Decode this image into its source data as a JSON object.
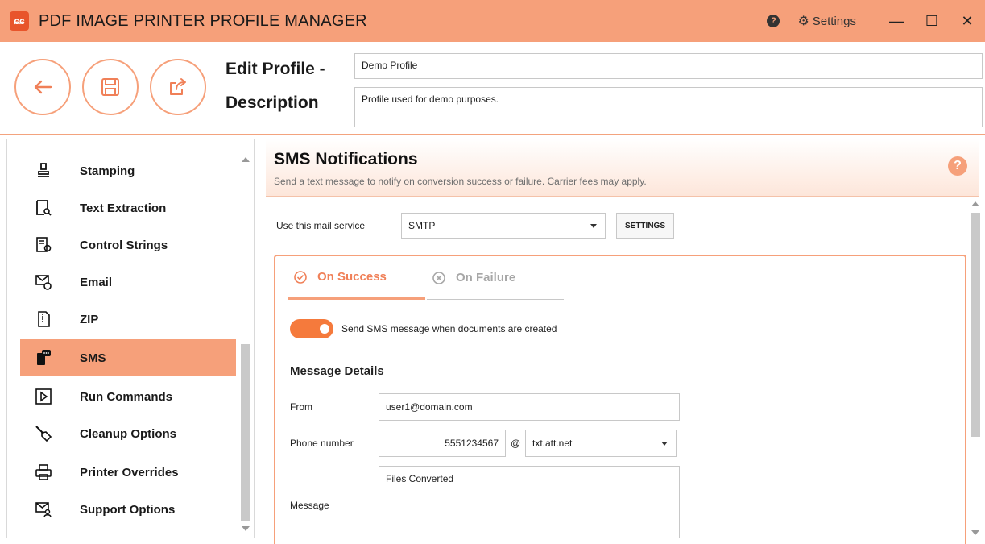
{
  "titlebar": {
    "logo_text": "ɕɕ",
    "title": "PDF IMAGE PRINTER PROFILE MANAGER",
    "help_glyph": "?",
    "settings_label": "Settings",
    "minimize": "—",
    "maximize": "☐",
    "close": "✕"
  },
  "header": {
    "edit_profile_label": "Edit Profile -",
    "profile_name": "Demo Profile",
    "description_label": "Description",
    "description_value": "Profile used for demo purposes."
  },
  "sidebar": {
    "items": [
      {
        "label": "Stamping",
        "icon": "stamp-icon"
      },
      {
        "label": "Text Extraction",
        "icon": "text-extraction-icon"
      },
      {
        "label": "Control Strings",
        "icon": "control-strings-icon"
      },
      {
        "label": "Email",
        "icon": "email-icon"
      },
      {
        "label": "ZIP",
        "icon": "zip-icon"
      },
      {
        "label": "SMS",
        "icon": "sms-icon",
        "active": true
      },
      {
        "label": "Run Commands",
        "icon": "run-commands-icon"
      },
      {
        "label": "Cleanup Options",
        "icon": "broom-icon"
      },
      {
        "label": "Printer Overrides",
        "icon": "printer-icon"
      },
      {
        "label": "Support Options",
        "icon": "support-icon"
      }
    ]
  },
  "section": {
    "title": "SMS Notifications",
    "subtitle": "Send a text message to notify on conversion success or failure. Carrier fees may apply.",
    "help_glyph": "?"
  },
  "mail_service": {
    "label": "Use this mail service",
    "value": "SMTP",
    "settings_button": "SETTINGS"
  },
  "tabs": {
    "success": "On Success",
    "failure": "On Failure"
  },
  "toggle": {
    "on": true,
    "label": "Send SMS message when documents are created"
  },
  "message_details": {
    "title": "Message Details",
    "from_label": "From",
    "from_value": "user1@domain.com",
    "phone_label": "Phone number",
    "phone_value": "5551234567",
    "at_symbol": "@",
    "carrier_value": "txt.att.net",
    "message_label": "Message",
    "message_value": "Files Converted"
  },
  "colors": {
    "accent": "#f6a07a",
    "accent_dark": "#f08058",
    "toggle": "#f57a3c"
  }
}
